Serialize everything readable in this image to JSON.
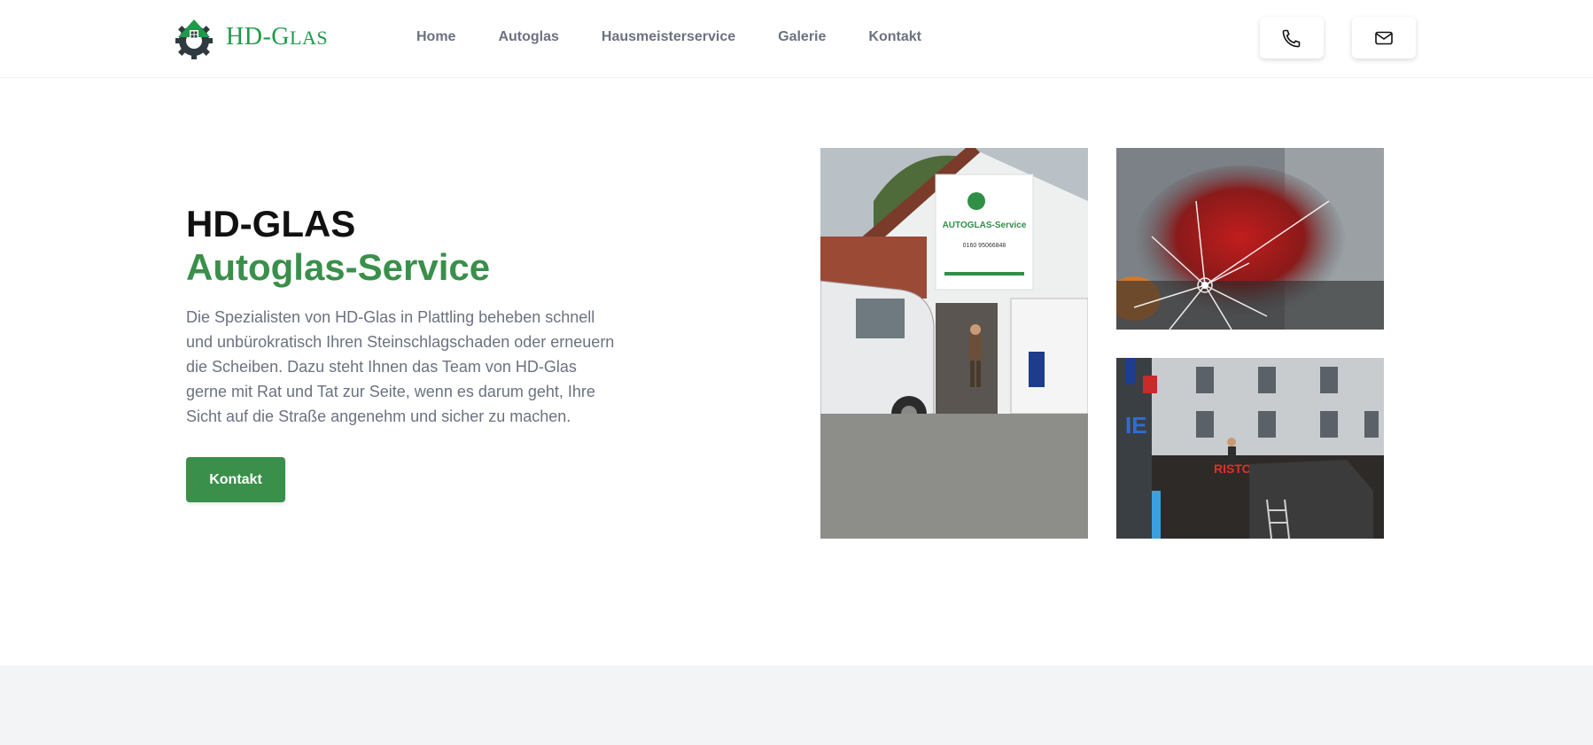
{
  "brand": {
    "name_prefix": "HD-G",
    "name_suffix": "LAS",
    "color": "#1f9a4a"
  },
  "nav": {
    "items": [
      {
        "label": "Home"
      },
      {
        "label": "Autoglas"
      },
      {
        "label": "Hausmeisterservice"
      },
      {
        "label": "Galerie"
      },
      {
        "label": "Kontakt"
      }
    ]
  },
  "header_actions": {
    "phone_icon": "phone-icon",
    "mail_icon": "mail-icon"
  },
  "hero": {
    "title": "HD-GLAS",
    "subtitle": "Autoglas-Service",
    "description": "Die Spezialisten von HD-Glas in Plattling beheben schnell und unbürokratisch Ihren Steinschlagschaden oder erneuern die Scheiben. Dazu steht Ihnen das Team von HD-Glas gerne mit Rat und Tat zur Seite, wenn es darum geht, Ihre Sicht auf die Straße angenehm und sicher zu machen.",
    "cta_label": "Kontakt",
    "accent_color": "#3a8f4b"
  },
  "gallery": {
    "photo1_sign_title": "AUTOGLAS-Service",
    "photo1_sign_phone": "0160 95066848"
  }
}
